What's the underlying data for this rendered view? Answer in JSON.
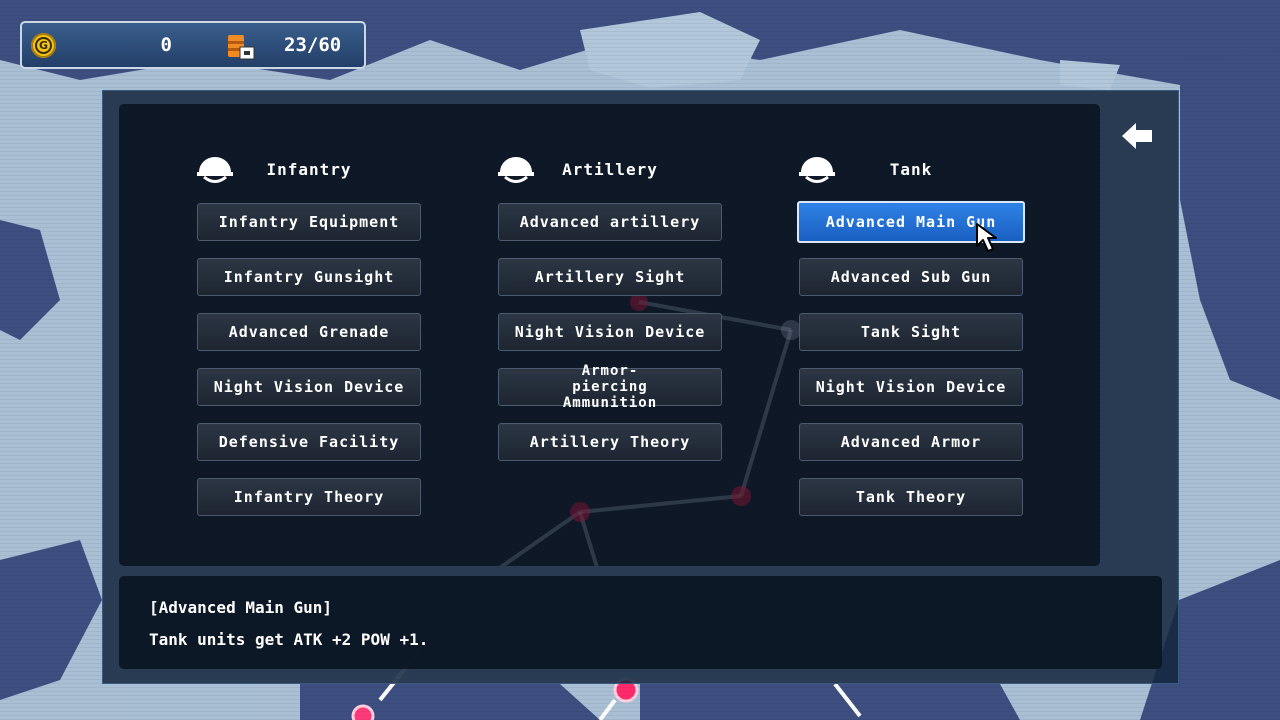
{
  "resources": {
    "gold_icon": "gold-coin-icon",
    "gold_symbol": "G",
    "gold": "0",
    "supply_icon": "oil-barrel-icon",
    "supply": "23/60"
  },
  "back_icon": "back-arrow-icon",
  "columns": [
    {
      "title": "Infantry",
      "icon": "helmet-icon",
      "items": [
        "Infantry Equipment",
        "Infantry Gunsight",
        "Advanced Grenade",
        "Night Vision Device",
        "Defensive Facility",
        "Infantry Theory"
      ]
    },
    {
      "title": "Artillery",
      "icon": "helmet-icon",
      "items": [
        "Advanced artillery",
        "Artillery Sight",
        "Night Vision Device",
        "Armor-piercing Ammunition",
        "Artillery Theory"
      ]
    },
    {
      "title": "Tank",
      "icon": "helmet-icon",
      "items": [
        "Advanced Main Gun",
        "Advanced Sub Gun",
        "Tank Sight",
        "Night Vision Device",
        "Advanced Armor",
        "Tank Theory"
      ]
    }
  ],
  "selected": "Advanced Main Gun",
  "description": {
    "title": "[Advanced Main Gun]",
    "text": "Tank units get ATK +2 POW +1."
  },
  "colors": {
    "selected_button": "#2a78e0",
    "panel": "#0c1624",
    "resource_bar": "#2a4a75",
    "gold": "#f2c418"
  }
}
